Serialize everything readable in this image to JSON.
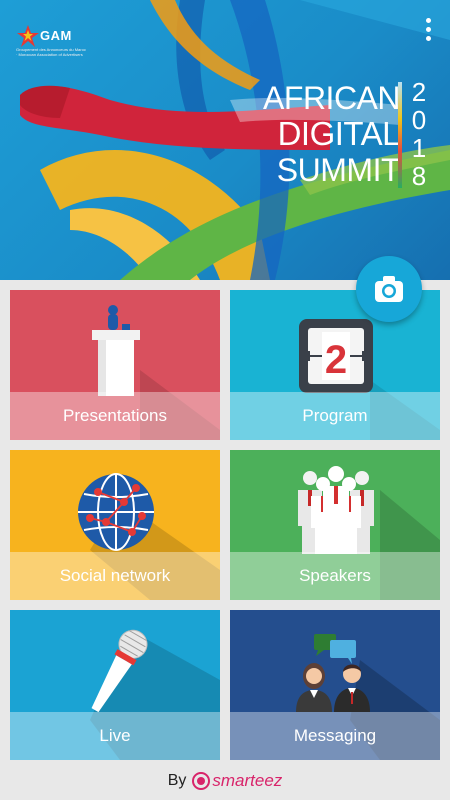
{
  "header": {
    "logo": {
      "name": "GAM",
      "subtitle": "Groupement des Annonceurs du Maroc · Moroccan Association of Advertisers"
    },
    "menu_icon": "more-vert-icon",
    "title_lines": [
      "AFRICAN",
      "DIGITAL",
      "SUMMIT"
    ],
    "year_digits": [
      "2",
      "0",
      "1",
      "8"
    ],
    "camera_icon": "camera-icon"
  },
  "tiles": [
    {
      "label": "Presentations",
      "icon": "podium-icon",
      "color": "#d9505e"
    },
    {
      "label": "Program",
      "icon": "calendar-icon",
      "color": "#19b3d3",
      "calendar_number": "2"
    },
    {
      "label": "Social network",
      "icon": "globe-network-icon",
      "color": "#f7b31e"
    },
    {
      "label": "Speakers",
      "icon": "speakers-icon",
      "color": "#4cb05a"
    },
    {
      "label": "Live",
      "icon": "microphone-icon",
      "color": "#1ba3d3"
    },
    {
      "label": "Messaging",
      "icon": "chat-people-icon",
      "color": "#244e8e"
    }
  ],
  "footer": {
    "by": "By",
    "brand": "smarteez",
    "brand_color": "#d8246a"
  }
}
